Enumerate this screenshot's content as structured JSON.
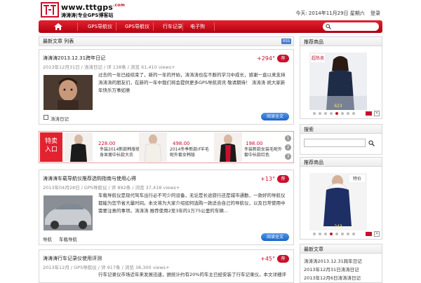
{
  "header": {
    "site_url": "www.tttgps",
    "site_tld": ".com",
    "site_sub": "涛涛涛|专业GPS博客站",
    "date_text": "今天: 2014年11月29日 星期六",
    "lang_link": "登录"
  },
  "nav": {
    "items": [
      "GPS导航仪",
      "GPS导航仪",
      "行车记录",
      "电子狗"
    ]
  },
  "latest": {
    "title": "最新文章 列表",
    "rss": "RSS"
  },
  "posts": [
    {
      "title": "涛涛涛2013.12.31跨年日记",
      "meta": "2013年12月31日 / 涛涛日记 / 评 138条 / 浏览 61,410 views+",
      "count": "+294°",
      "badge": "荐",
      "text": "过去的一年已经结束了，新的一年的开始，涛涛涛也在不断的学习中成长，感谢一直以来支持涛涛涛的朋友们，在新的一年中我们将会提供更多GPS导航资讯 敬请期待！ 涛涛涛 祝大家新年快乐万事如意",
      "tag": "涛涛日记",
      "more": "阅读全文"
    },
    {
      "title": "涛涛涛车载导航仪推荐选购指南与使用心得",
      "meta": "2013年04月28日 / GPS导航仪 / 评 892条 / 浏览 37,418 views+",
      "count": "+13°",
      "badge": "荐",
      "text": "车载导航仪是现代驾车出行必不可少的设备，无论是长途旅行还是城市通勤，一款好的导航仪都能为您节省大量时间。本文将为大家介绍如何选购一款适合自己的导航仪，以及日常使用中需要注意的事项。涛涛涛 推荐使用2至3年的1万75公里的车辆...",
      "tag1": "导航",
      "tag2": "车载导航",
      "more": "阅读全文"
    },
    {
      "title": "涛涛涛行车记录仪使用评测",
      "meta": "2013年12月 / GPS导航仪 / 评 917条 / 浏览 38,300 views+",
      "count": "+45°",
      "badge": "荐",
      "text": "行车记录仪市场近年来发展迅速，据统计约有20%的车主已经安装了行车记录仪，本文详细评测..."
    }
  ],
  "promo": {
    "label1": "特卖",
    "label2": "入口",
    "items": [
      {
        "price": "228.00",
        "desc": "冬装2014新款韩版修身显瘦中长款大衣"
      },
      {
        "price": "498.00",
        "desc": "2014冬季新款rf羊毛呢外套女韩版"
      },
      {
        "price": "198.00",
        "desc": "冬装新款女装毛呢外套中长款红色"
      }
    ],
    "pager": [
      "1",
      "2",
      "3"
    ]
  },
  "sidebar": {
    "box1_title": "推荐商品",
    "box1_price": "623",
    "box1_img_tag": "超热卖",
    "box2_title": "搜索",
    "box3_title": "推荐商品",
    "box3_price": "243",
    "box3_img_tag": "特价",
    "box4_title": "最新文章",
    "box4_items": [
      "涛涛涛2013.12.31跨年日记",
      "2013年12月31日涛涛日记",
      "2013年12月6日涛涛涛日记"
    ]
  },
  "colors": {
    "brand_red": "#c8102e",
    "nav_red": "#d4101e",
    "button_blue": "#2f77d6"
  }
}
